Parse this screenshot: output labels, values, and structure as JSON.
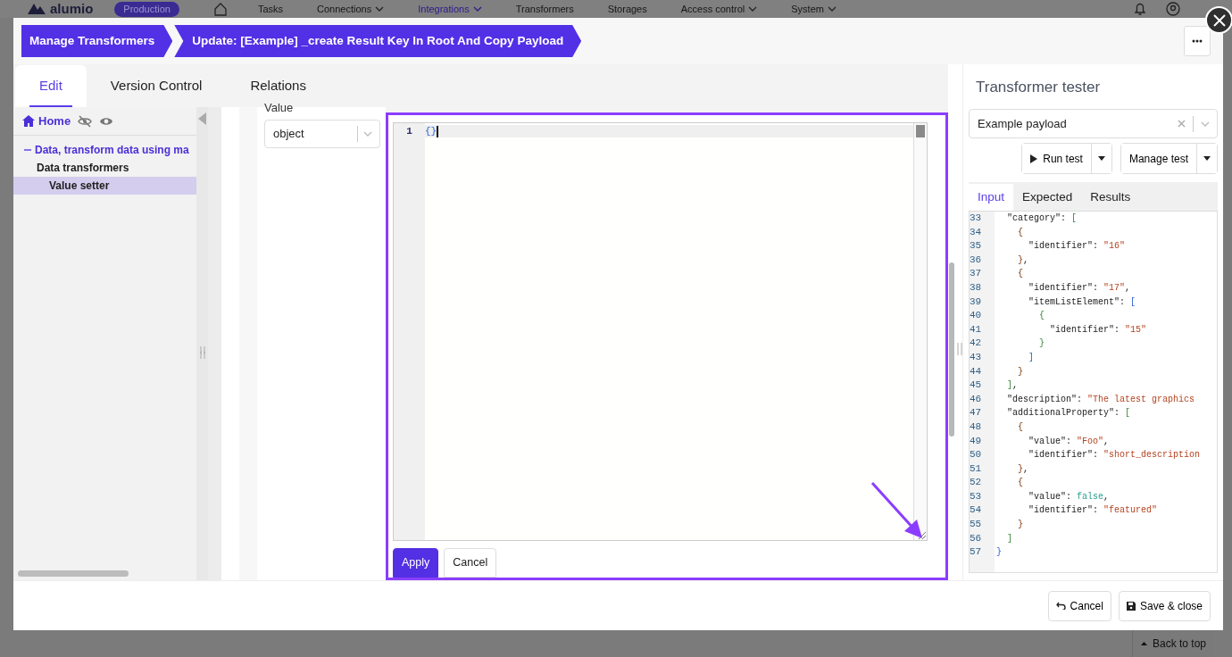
{
  "top_nav": {
    "logo": "alumio",
    "environment": "Production",
    "items": [
      {
        "label": "Tasks",
        "dropdown": false,
        "selected": false
      },
      {
        "label": "Connections",
        "dropdown": true,
        "selected": false
      },
      {
        "label": "Integrations",
        "dropdown": true,
        "selected": true
      },
      {
        "label": "Transformers",
        "dropdown": false,
        "selected": false
      },
      {
        "label": "Storages",
        "dropdown": false,
        "selected": false
      },
      {
        "label": "Access control",
        "dropdown": true,
        "selected": false
      },
      {
        "label": "System",
        "dropdown": true,
        "selected": false
      }
    ]
  },
  "breadcrumb": [
    {
      "label": "Manage Transformers"
    },
    {
      "label": "Update: [Example] _create Result Key In Root And Copy Payload"
    }
  ],
  "tabs": [
    {
      "label": "Edit",
      "selected": true
    },
    {
      "label": "Version Control",
      "selected": false
    },
    {
      "label": "Relations",
      "selected": false
    }
  ],
  "sidebar": {
    "home": "Home",
    "tree": [
      {
        "label": "Data, transform data using ma",
        "expanded": true,
        "selected": false,
        "children": [
          {
            "label": "Data transformers",
            "selected": false,
            "children": [
              {
                "label": "Value setter",
                "selected": true
              }
            ]
          }
        ]
      }
    ]
  },
  "form": {
    "field_label": "Value",
    "type_select": "object"
  },
  "editor": {
    "lines": [
      {
        "number": "1",
        "text": "{}"
      }
    ],
    "buttons": [
      {
        "label": "Apply",
        "kind": "primary"
      },
      {
        "label": "Cancel",
        "kind": "secondary"
      }
    ]
  },
  "tester": {
    "title": "Transformer tester",
    "payload_select": "Example payload",
    "buttons": [
      {
        "label": "Run test",
        "kind": "run"
      },
      {
        "label": "Manage test",
        "kind": "manage"
      }
    ],
    "tabs": [
      {
        "label": "Input",
        "selected": true
      },
      {
        "label": "Expected",
        "selected": false
      },
      {
        "label": "Results",
        "selected": false
      }
    ],
    "code_lines": [
      {
        "number": "33",
        "text": "  \"category\": ["
      },
      {
        "number": "34",
        "text": "    {"
      },
      {
        "number": "35",
        "text": "      \"identifier\": \"16\""
      },
      {
        "number": "36",
        "text": "    },"
      },
      {
        "number": "37",
        "text": "    {"
      },
      {
        "number": "38",
        "text": "      \"identifier\": \"17\","
      },
      {
        "number": "39",
        "text": "      \"itemListElement\": ["
      },
      {
        "number": "40",
        "text": "        {"
      },
      {
        "number": "41",
        "text": "          \"identifier\": \"15\""
      },
      {
        "number": "42",
        "text": "        }"
      },
      {
        "number": "43",
        "text": "      ]"
      },
      {
        "number": "44",
        "text": "    }"
      },
      {
        "number": "45",
        "text": "  ],"
      },
      {
        "number": "46",
        "text": "  \"description\": \"The latest graphics"
      },
      {
        "number": "47",
        "text": "  \"additionalProperty\": ["
      },
      {
        "number": "48",
        "text": "    {"
      },
      {
        "number": "49",
        "text": "      \"value\": \"Foo\","
      },
      {
        "number": "50",
        "text": "      \"identifier\": \"short_description"
      },
      {
        "number": "51",
        "text": "    },"
      },
      {
        "number": "52",
        "text": "    {"
      },
      {
        "number": "53",
        "text": "      \"value\": false,"
      },
      {
        "number": "54",
        "text": "      \"identifier\": \"featured\""
      },
      {
        "number": "55",
        "text": "    }"
      },
      {
        "number": "56",
        "text": "  ]"
      },
      {
        "number": "57",
        "text": "}"
      }
    ]
  },
  "footer": {
    "buttons": [
      {
        "label": "Cancel",
        "kind": "cancel"
      },
      {
        "label": "Save & close",
        "kind": "save"
      }
    ]
  },
  "back_to_top": "Back to top"
}
